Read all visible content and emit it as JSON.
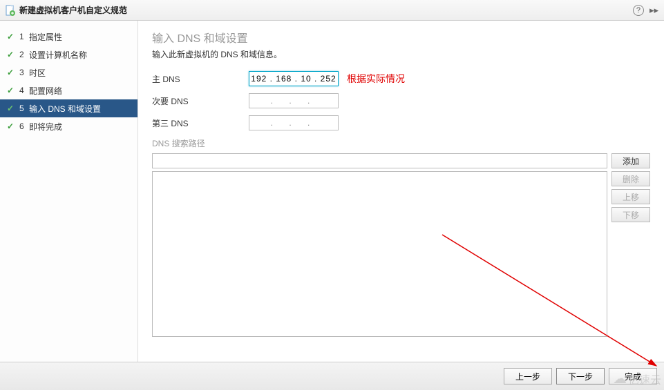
{
  "title": "新建虚拟机客户机自定义规范",
  "sidebar": {
    "items": [
      {
        "num": "1",
        "label": "指定属性",
        "checked": true
      },
      {
        "num": "2",
        "label": "设置计算机名称",
        "checked": true
      },
      {
        "num": "3",
        "label": "时区",
        "checked": true
      },
      {
        "num": "4",
        "label": "配置网络",
        "checked": true
      },
      {
        "num": "5",
        "label": "输入 DNS 和域设置",
        "checked": true,
        "active": true
      },
      {
        "num": "6",
        "label": "即将完成",
        "checked": true
      }
    ]
  },
  "section": {
    "title": "输入 DNS 和域设置",
    "desc": "输入此新虚拟机的 DNS 和域信息。"
  },
  "dns": {
    "primary_label": "主 DNS",
    "primary_value": "192 . 168 .   10  . 252",
    "secondary_label": "次要 DNS",
    "secondary_value": ".        .        .",
    "tertiary_label": "第三 DNS",
    "tertiary_value": ".        .        ."
  },
  "annotation": "根据实际情况",
  "dns_search_label": "DNS 搜索路径",
  "buttons": {
    "add": "添加",
    "delete": "删除",
    "up": "上移",
    "down": "下移"
  },
  "footer": {
    "back": "上一步",
    "next": "下一步",
    "finish": "完成"
  },
  "watermark": "亿速云"
}
